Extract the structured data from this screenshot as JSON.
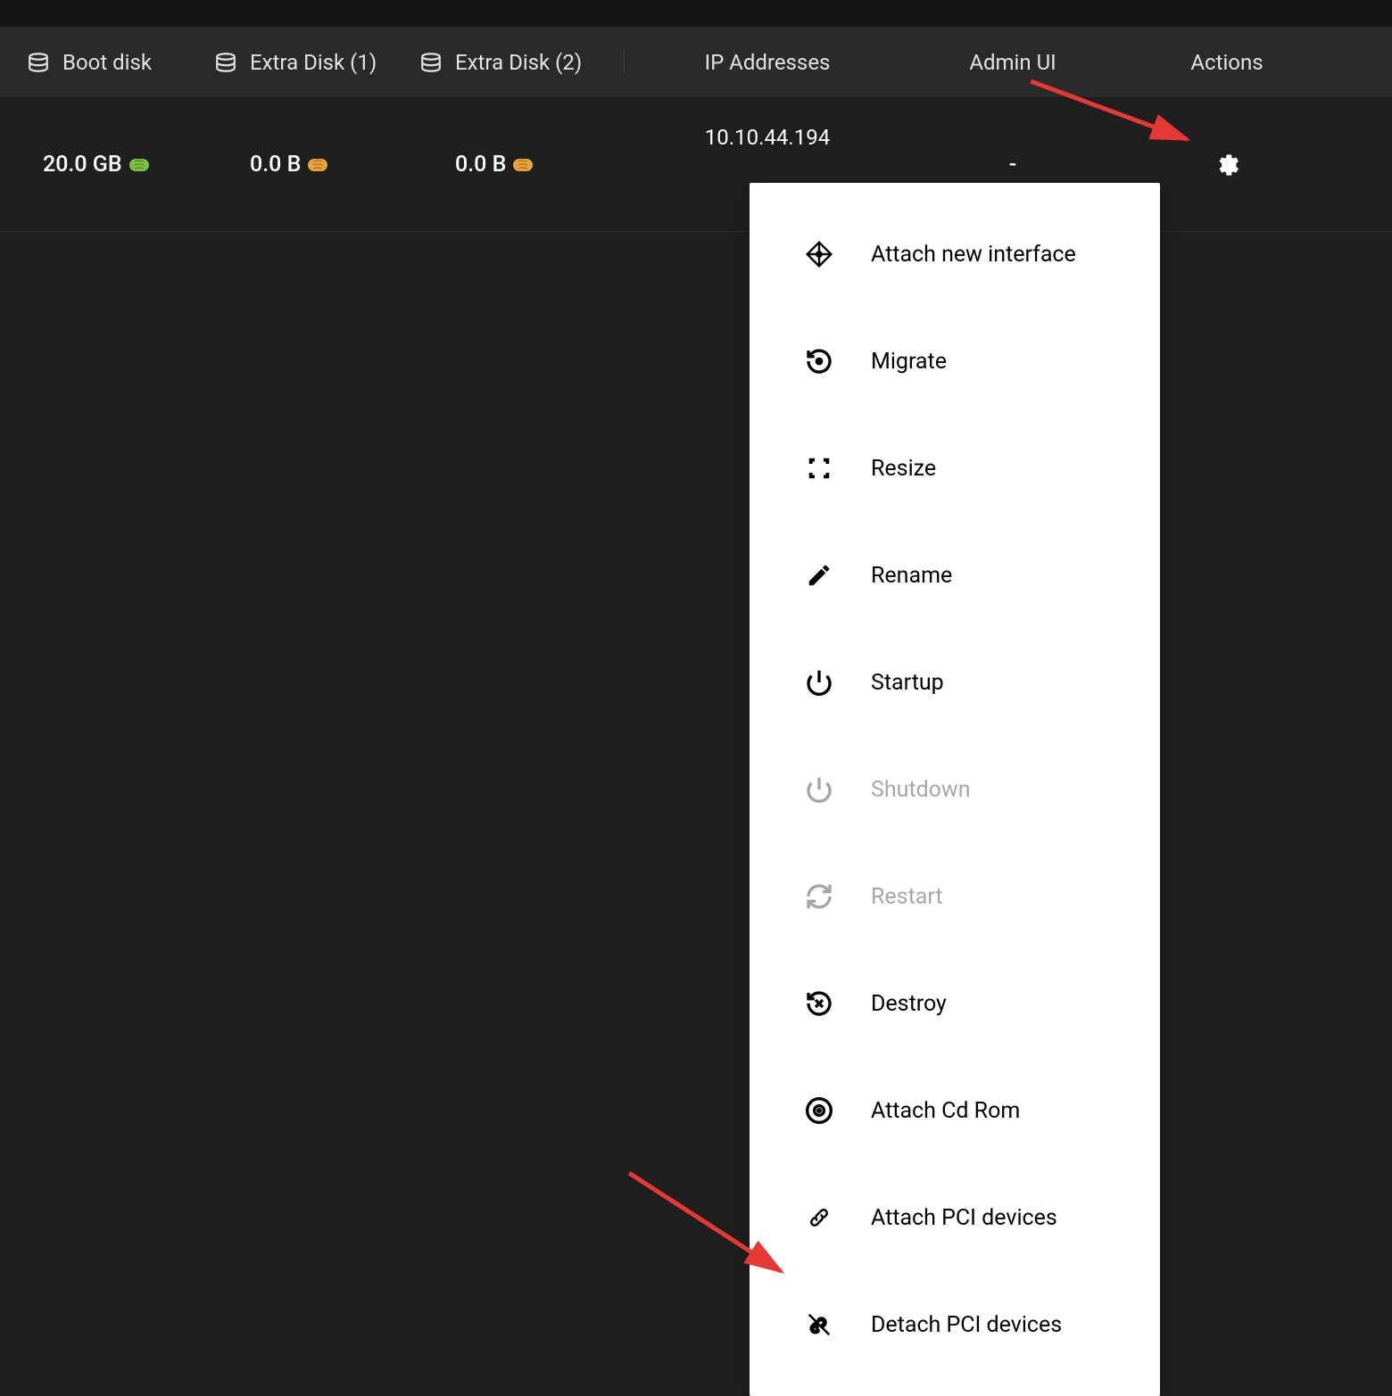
{
  "header": {
    "columns": [
      {
        "id": "boot-disk",
        "label": "Boot disk",
        "icon": "disk"
      },
      {
        "id": "extra-disk-1",
        "label": "Extra Disk (1)",
        "icon": "disk"
      },
      {
        "id": "extra-disk-2",
        "label": "Extra Disk (2)",
        "icon": "disk"
      },
      {
        "id": "ip",
        "label": "IP Addresses"
      },
      {
        "id": "admin-ui",
        "label": "Admin UI"
      },
      {
        "id": "actions",
        "label": "Actions"
      }
    ]
  },
  "row": {
    "boot_disk": "20.0 GB",
    "extra_disk_1": "0.0 B",
    "extra_disk_2": "0.0 B",
    "ip_address": "10.10.44.194",
    "admin_ui": "-"
  },
  "menu": {
    "items": [
      {
        "id": "attach-interface",
        "label": "Attach new interface",
        "icon": "network",
        "disabled": false
      },
      {
        "id": "migrate",
        "label": "Migrate",
        "icon": "migrate",
        "disabled": false
      },
      {
        "id": "resize",
        "label": "Resize",
        "icon": "resize",
        "disabled": false
      },
      {
        "id": "rename",
        "label": "Rename",
        "icon": "edit",
        "disabled": false
      },
      {
        "id": "startup",
        "label": "Startup",
        "icon": "power",
        "disabled": false
      },
      {
        "id": "shutdown",
        "label": "Shutdown",
        "icon": "power",
        "disabled": true
      },
      {
        "id": "restart",
        "label": "Restart",
        "icon": "refresh",
        "disabled": true
      },
      {
        "id": "destroy",
        "label": "Destroy",
        "icon": "destroy",
        "disabled": false
      },
      {
        "id": "attach-cdrom",
        "label": "Attach Cd Rom",
        "icon": "disc",
        "disabled": false
      },
      {
        "id": "attach-pci",
        "label": "Attach PCI devices",
        "icon": "link",
        "disabled": false
      },
      {
        "id": "detach-pci",
        "label": "Detach PCI devices",
        "icon": "unlink",
        "disabled": false
      }
    ]
  }
}
